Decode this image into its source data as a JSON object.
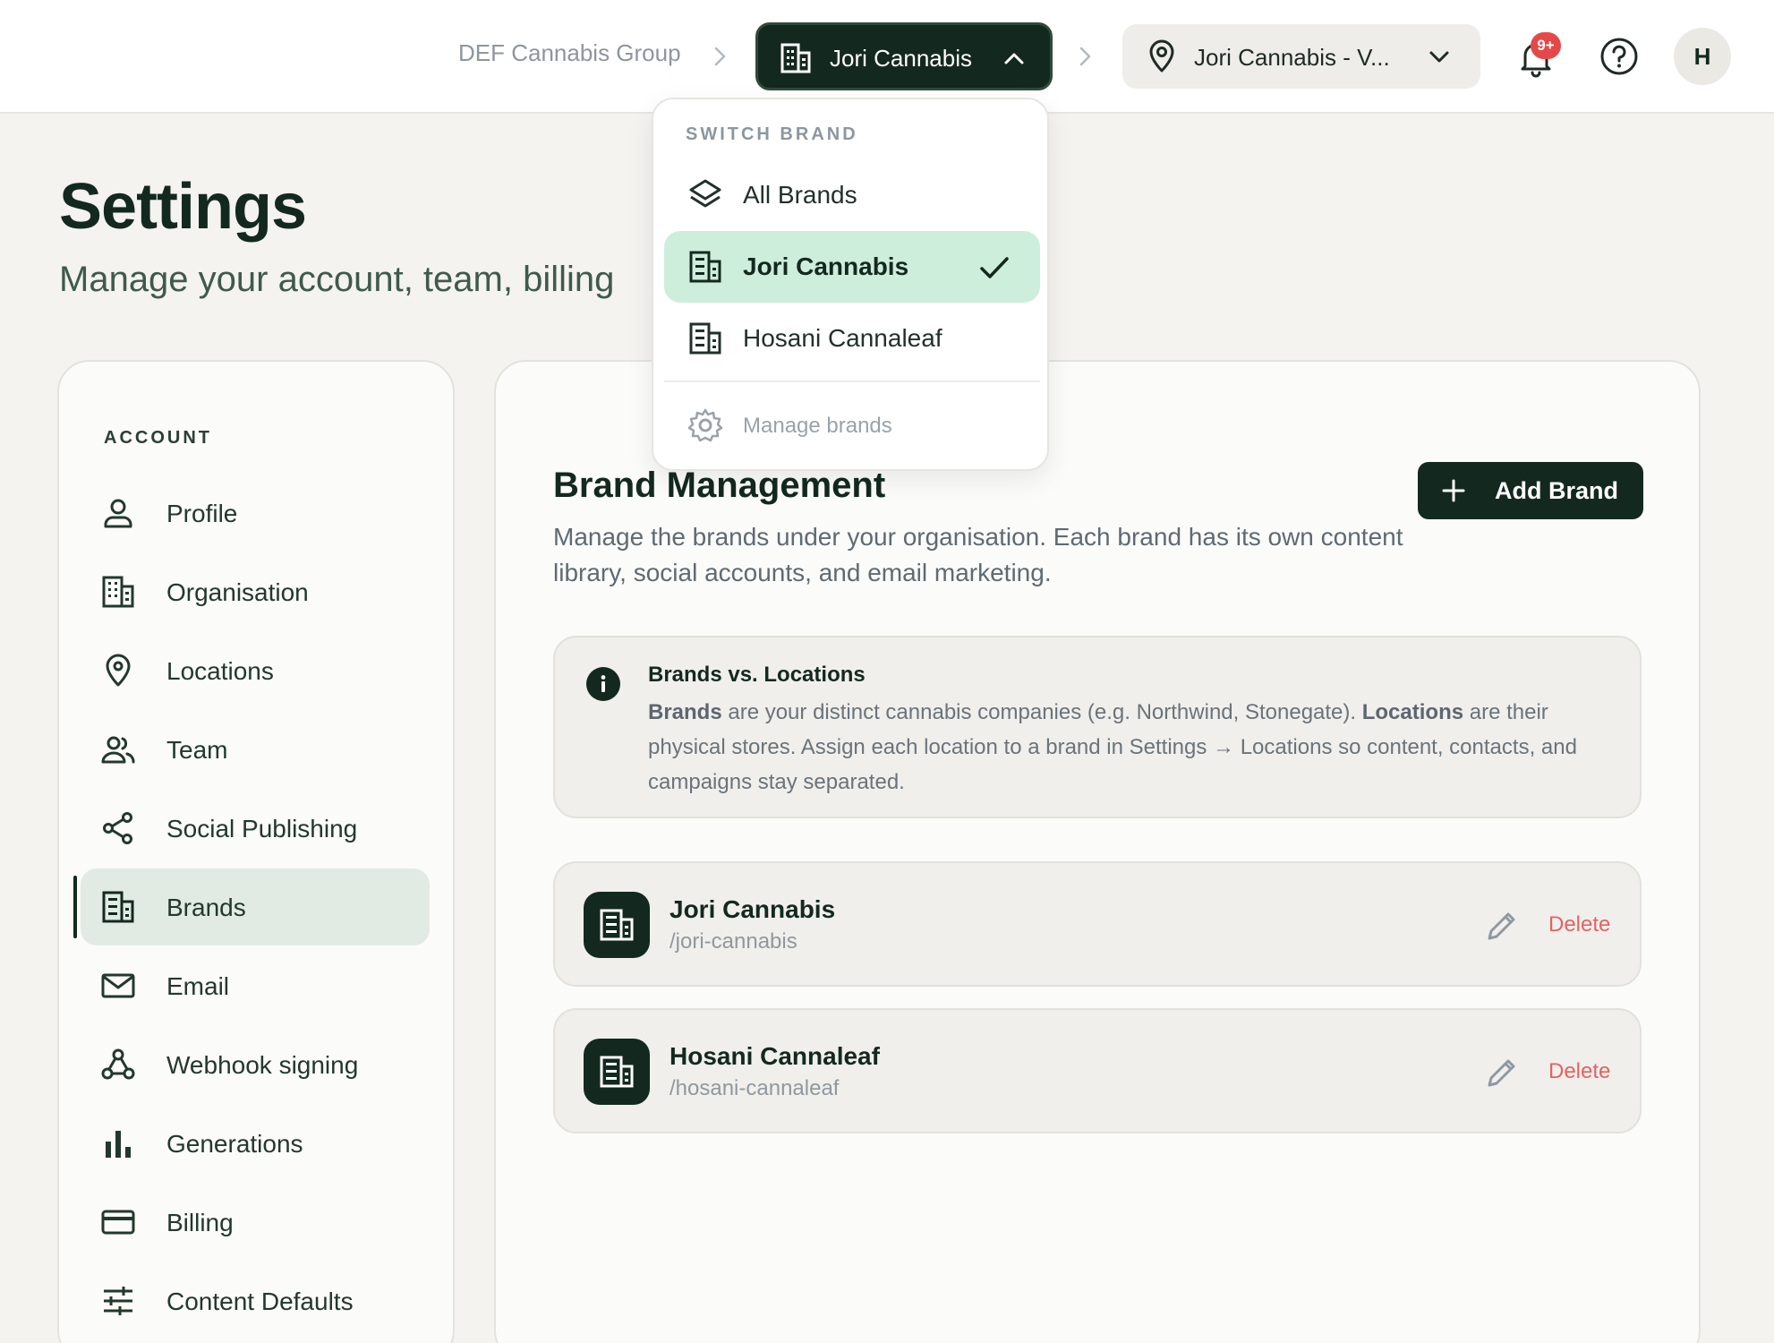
{
  "topbar": {
    "org_breadcrumb": "DEF Cannabis Group",
    "brand_switcher_label": "Jori Cannabis",
    "location_switcher_label": "Jori Cannabis - V...",
    "notification_badge": "9+",
    "avatar_initial": "H"
  },
  "brand_dropdown": {
    "heading": "SWITCH BRAND",
    "items": [
      {
        "label": "All Brands",
        "icon": "layers-icon",
        "selected": false
      },
      {
        "label": "Jori Cannabis",
        "icon": "building-icon",
        "selected": true
      },
      {
        "label": "Hosani Cannaleaf",
        "icon": "building-icon",
        "selected": false
      }
    ],
    "manage_label": "Manage brands"
  },
  "page": {
    "title": "Settings",
    "subtitle": "Manage your account, team, billing"
  },
  "sidebar": {
    "heading": "ACCOUNT",
    "items": [
      {
        "label": "Profile",
        "icon": "user-icon"
      },
      {
        "label": "Organisation",
        "icon": "organisation-icon"
      },
      {
        "label": "Locations",
        "icon": "map-pin-icon"
      },
      {
        "label": "Team",
        "icon": "team-icon"
      },
      {
        "label": "Social Publishing",
        "icon": "share-icon"
      },
      {
        "label": "Brands",
        "icon": "building-icon",
        "active": true
      },
      {
        "label": "Email",
        "icon": "mail-icon"
      },
      {
        "label": "Webhook signing",
        "icon": "webhook-icon"
      },
      {
        "label": "Generations",
        "icon": "bar-chart-icon"
      },
      {
        "label": "Billing",
        "icon": "credit-card-icon"
      },
      {
        "label": "Content Defaults",
        "icon": "sliders-icon"
      }
    ]
  },
  "main": {
    "title": "Brand Management",
    "description": "Manage the brands under your organisation. Each brand has its own content library, social accounts, and email marketing.",
    "add_button": "Add Brand",
    "info": {
      "title": "Brands vs. Locations",
      "brands_term": "Brands",
      "text_1": " are your distinct cannabis companies (e.g. Northwind, Stonegate). ",
      "locations_term": "Locations",
      "text_2": " are their physical stores. Assign each location to a brand in Settings → Locations so content, contacts, and campaigns stay separated."
    },
    "brands": [
      {
        "name": "Jori Cannabis",
        "slug": "/jori-cannabis",
        "delete_label": "Delete"
      },
      {
        "name": "Hosani Cannaleaf",
        "slug": "/hosani-cannaleaf",
        "delete_label": "Delete"
      }
    ]
  },
  "colors": {
    "primary_dark": "#13291f",
    "selected_bg": "#cdeedb",
    "active_nav_bg": "#e1ebe3",
    "danger": "#e06464",
    "badge": "#e54848",
    "page_bg": "#f4f3ef"
  }
}
